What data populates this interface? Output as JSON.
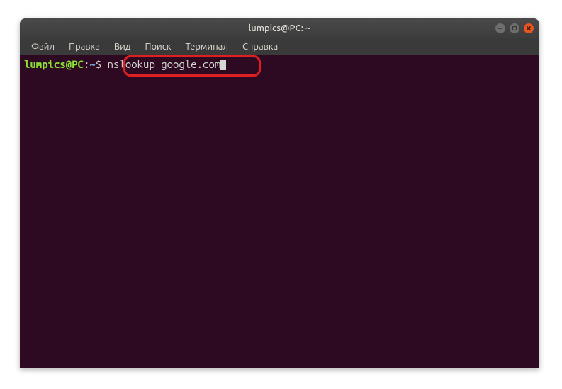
{
  "window": {
    "title": "lumpics@PC: ~"
  },
  "menu": {
    "file": "Файл",
    "edit": "Правка",
    "view": "Вид",
    "search": "Поиск",
    "terminal": "Терминал",
    "help": "Справка"
  },
  "prompt": {
    "user_host": "lumpics@PC",
    "colon": ":",
    "path": "~",
    "symbol": "$"
  },
  "command": "nslookup google.com"
}
